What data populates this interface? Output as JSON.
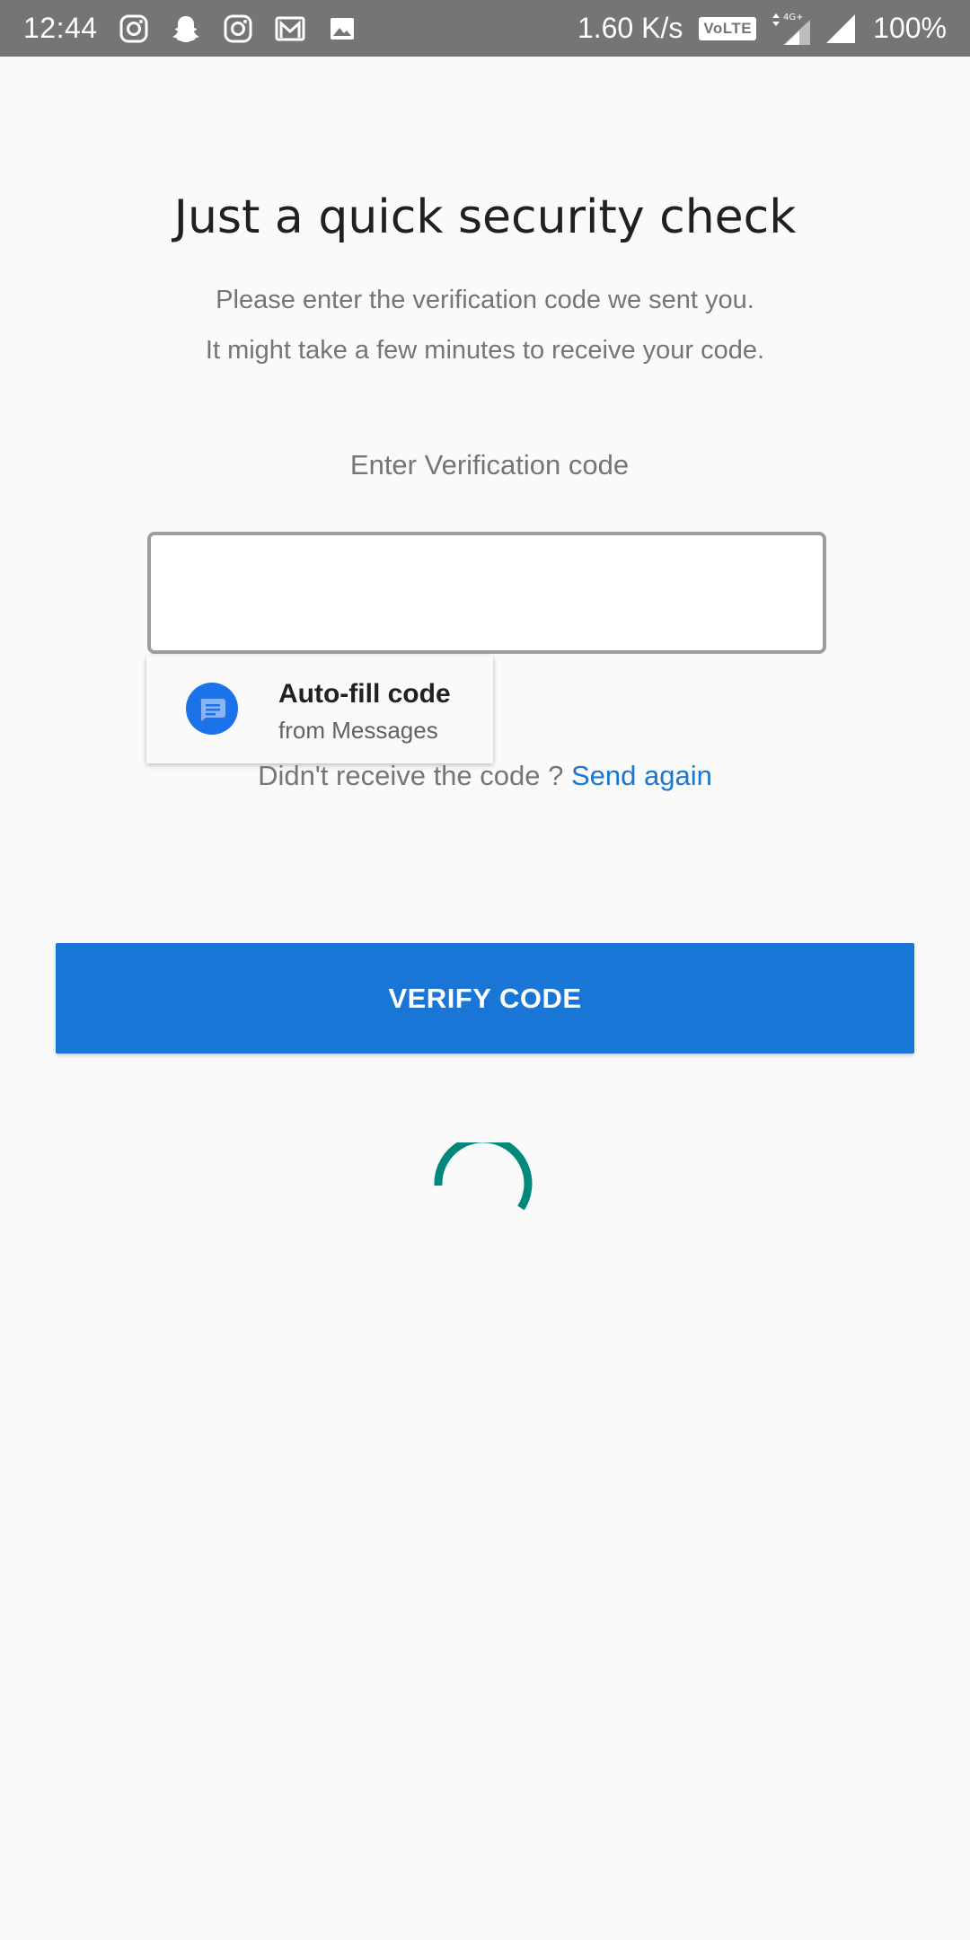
{
  "status_bar": {
    "time": "12:44",
    "notification_icons": [
      "instagram-icon",
      "snapchat-icon",
      "instagram-icon",
      "gmail-icon",
      "image-icon"
    ],
    "net_speed": "1.60 K/s",
    "volte": "VoLTE",
    "network": "4G+",
    "battery": "100%"
  },
  "page": {
    "title": "Just a quick security check",
    "subtitle_line1": "Please enter the verification code we sent you.",
    "subtitle_line2": "It might take a few minutes to receive your code.",
    "field_label": "Enter Verification code",
    "code_value": ""
  },
  "autofill": {
    "title": "Auto-fill code",
    "subtitle": "from Messages",
    "icon": "messages-icon"
  },
  "resend": {
    "prompt": "Didn't receive the code ?",
    "link": "Send again"
  },
  "verify_button": {
    "label": "VERIFY CODE"
  },
  "colors": {
    "accent": "#1a76d6",
    "link": "#1976d2",
    "spinner": "#00897b",
    "status_bar": "#757575"
  }
}
